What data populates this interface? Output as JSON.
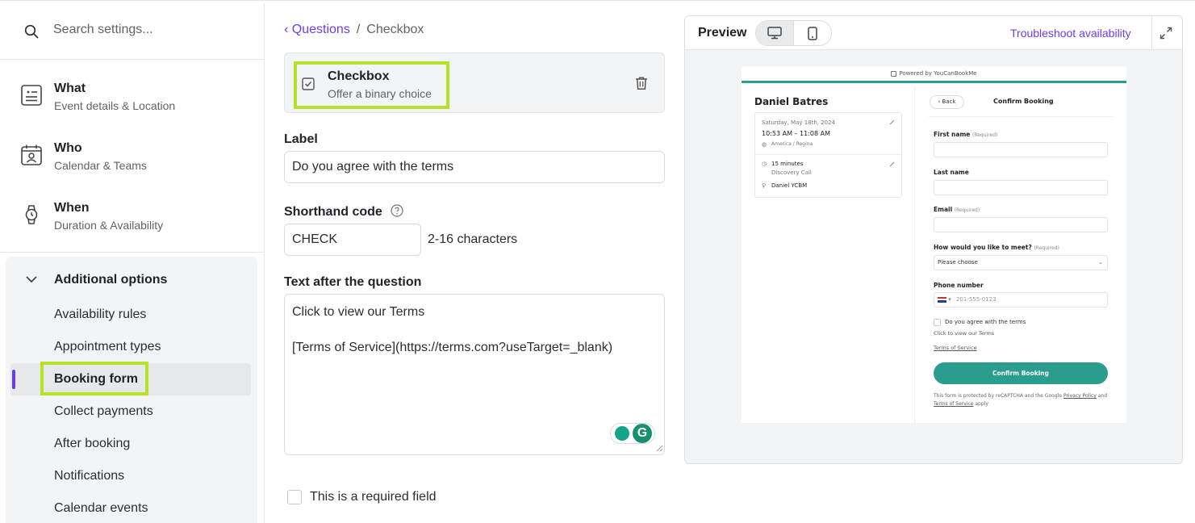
{
  "sidebar": {
    "search_placeholder": "Search settings...",
    "main": [
      {
        "title": "What",
        "subtitle": "Event details & Location"
      },
      {
        "title": "Who",
        "subtitle": "Calendar & Teams"
      },
      {
        "title": "When",
        "subtitle": "Duration & Availability"
      }
    ],
    "additional": {
      "label": "Additional options",
      "items": [
        "Availability rules",
        "Appointment types",
        "Booking form",
        "Collect payments",
        "After booking",
        "Notifications",
        "Calendar events"
      ]
    }
  },
  "breadcrumb": {
    "back": "Questions",
    "separator": "/",
    "current": "Checkbox"
  },
  "question_type": {
    "title": "Checkbox",
    "subtitle": "Offer a binary choice"
  },
  "form": {
    "label_title": "Label",
    "label_value": "Do you agree with the terms",
    "shorthand_title": "Shorthand code",
    "shorthand_value": "CHECK",
    "shorthand_hint": "2-16 characters",
    "text_after_title": "Text after the question",
    "text_after_line1": "Click to view our Terms",
    "text_after_line2": "[Terms of Service](https://terms.com?useTarget=_blank)",
    "required_label": "This is a required field"
  },
  "preview": {
    "title": "Preview",
    "troubleshoot": "Troubleshoot availability",
    "card": {
      "powered_by": "Powered by YouCanBookMe",
      "host": "Daniel Batres",
      "date": "Saturday, May 18th, 2024",
      "time": "10:53 AM – 11:08 AM",
      "timezone": "America / Regina",
      "duration": "15 minutes",
      "type": "Discovery Call",
      "person": "Daniel YCBM",
      "back": "Back",
      "confirm_title": "Confirm Booking",
      "required": "(Required)",
      "first_name": "First name",
      "last_name": "Last name",
      "email": "Email",
      "meet": "How would you like to meet?",
      "meet_placeholder": "Please choose",
      "phone": "Phone number",
      "phone_placeholder": "201-555-0123",
      "agree": "Do you agree with the terms",
      "click_terms": "Click to view our Terms",
      "terms_link": "Terms of Service",
      "confirm_button": "Confirm Booking",
      "legal_prefix": "This form is protected by reCAPTCHA and the Google",
      "legal_privacy": "Privacy Policy",
      "legal_and": "and",
      "legal_terms": "Terms of Service",
      "legal_suffix": "apply"
    }
  },
  "colors": {
    "accent": "#6b3cf5",
    "highlight": "#b6e22d",
    "brand": "#2a9d8f"
  }
}
